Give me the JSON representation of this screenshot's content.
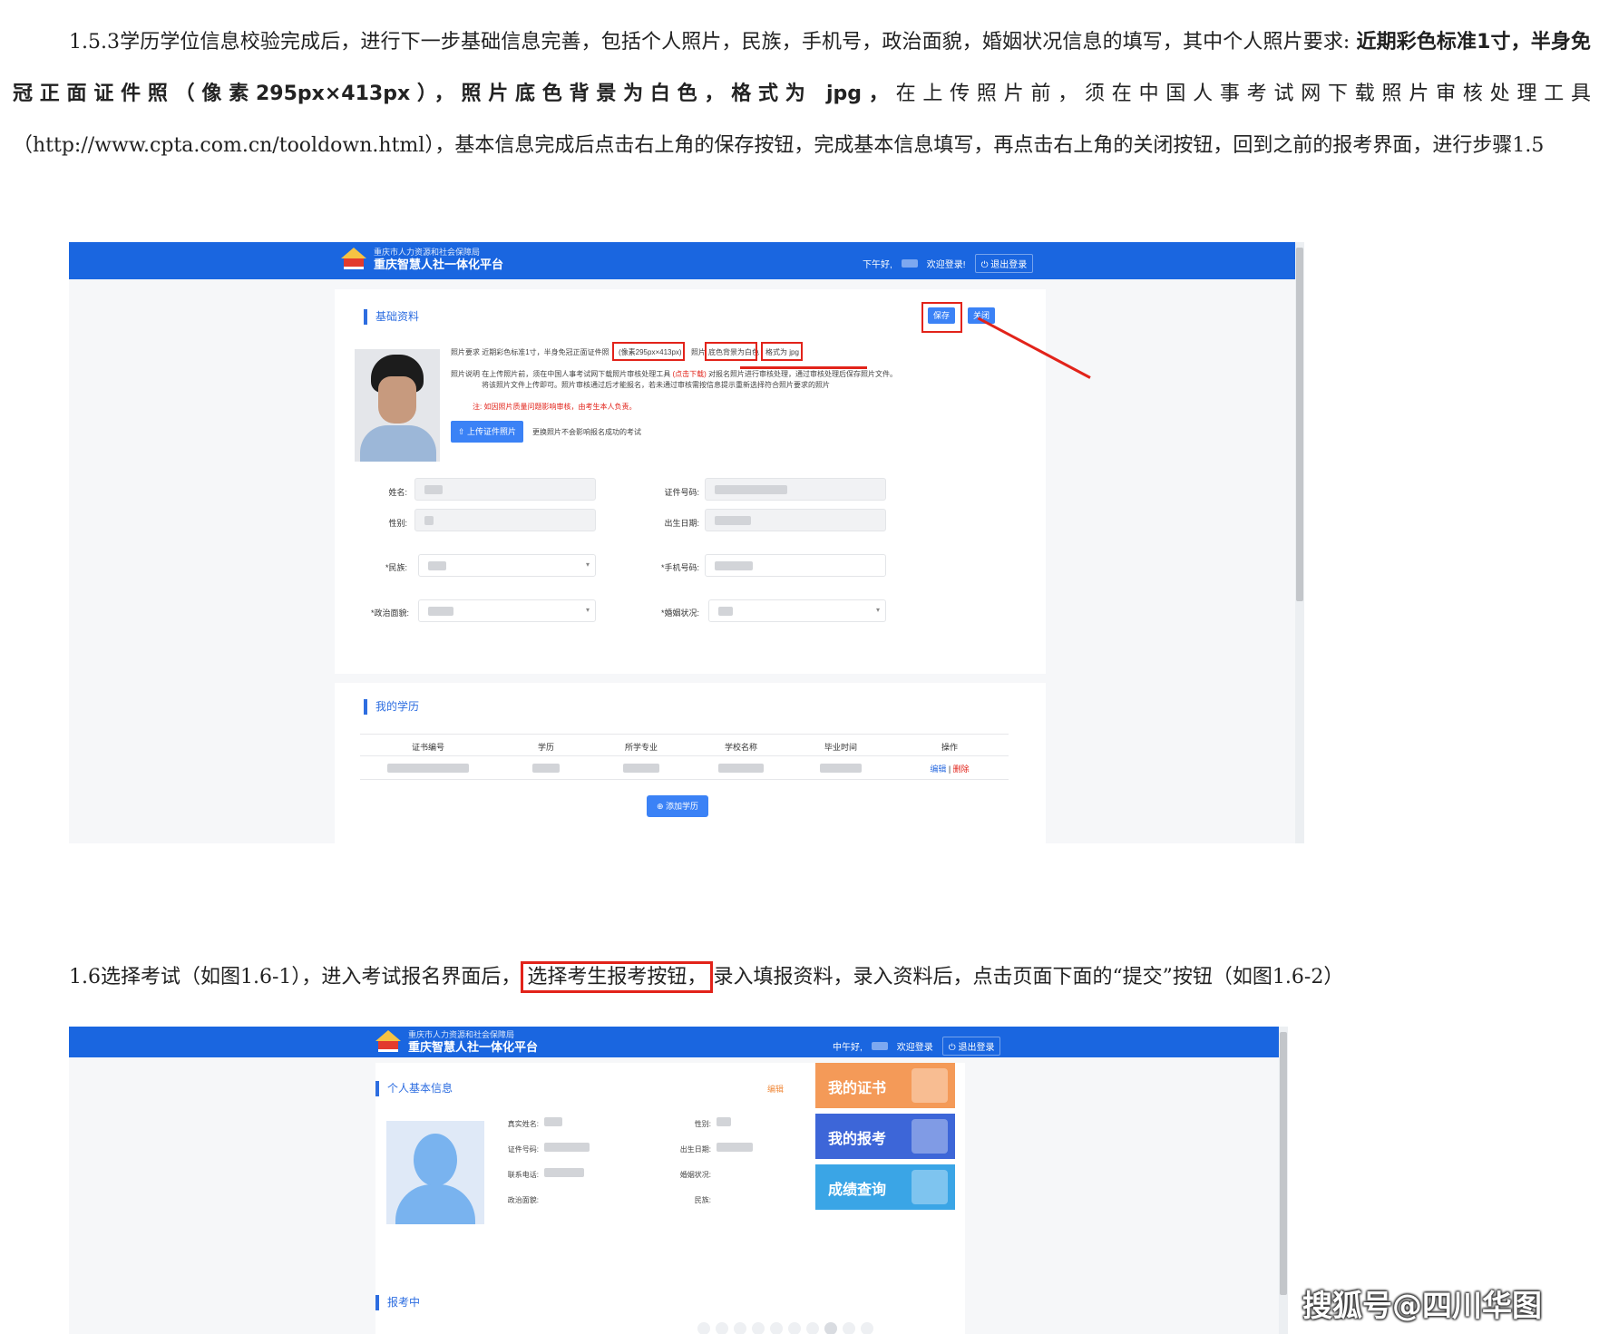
{
  "paragraph1": {
    "segment_a": "1.5.3学历学位信息校验完成后，进行下一步基础信息完善，包括个人照片，民族，手机号，政治面貌，婚姻状况信息的填写，其中个人照片要求: ",
    "segment_bold": "近期彩色标准1寸，半身免冠正面证件照（像素295px×413px），照片底色背景为白色，格式为 jpg，",
    "segment_b": "在上传照片前，须在中国人事考试网下载照片审核处理工具（http://www.cpta.com.cn/tooldown.html），基本信息完成后点击右上角的保存按钮，完成基本信息填写，再点击右上角的关闭按钮，回到之前的报考界面，进行步骤1.5"
  },
  "paragraph2": {
    "before": "1.6选择考试（如图1.6-1），进入考试报名界面后，",
    "highlight": "选择考生报考按钮，",
    "after": "录入填报资料，录入资料后，点击页面下面的“提交”按钮（如图1.6-2）"
  },
  "app": {
    "org_name": "重庆市人力资源和社会保障局",
    "platform_name": "重庆智慧人社一体化平台",
    "logout_label": "退出登录"
  },
  "shot1": {
    "greeting": "下午好,",
    "welcome": "欢迎登录!",
    "section_basic": "基础资料",
    "save_label": "保存",
    "close_label": "关闭",
    "photo_req_label": "照片要求",
    "photo_req_text": "近期彩色标准1寸，半身免冠正面证件照",
    "photo_req_pixels": "(像素295px×413px)",
    "photo_req_bg_prefix": "照片",
    "photo_req_bg": "底色背景为白色",
    "photo_req_format": "格式为 jpg",
    "photo_note_label": "照片说明",
    "photo_note_text_1": "在上传照片前，须在中国人事考试网下载照片审核处理工具",
    "photo_note_link": "(点击下载)",
    "photo_note_text_2": "对报名照片进行审核处理，通过审核处理后保存照片文件。",
    "photo_note_text_3": "将该照片文件上传即可。照片审核通过后才能报名，若未通过审核需按信息提示重新选择符合照片要求的照片",
    "photo_warning": "注: 如因照片质量问题影响审核，由考生本人负责。",
    "upload_label": "上传证件照片",
    "upload_hint": "更换照片不会影响报名成功的考试",
    "fields": {
      "name": "姓名:",
      "id_number": "证件号码:",
      "gender": "性别:",
      "birth_date": "出生日期:",
      "ethnicity": "*民族:",
      "phone": "*手机号码:",
      "political_status": "*政治面貌:",
      "marital_status": "*婚姻状况:"
    },
    "section_education": "我的学历",
    "edu_headers": [
      "证书编号",
      "学历",
      "所学专业",
      "学校名称",
      "毕业时间",
      "操作"
    ],
    "edu_action_edit": "编辑",
    "edu_action_delete": "删除",
    "add_education_label": "添加学历"
  },
  "shot2": {
    "greeting": "中午好,",
    "welcome": "欢迎登录",
    "section_personal": "个人基本信息",
    "edit_label": "编辑",
    "fields_left": [
      "真实姓名:",
      "证件号码:",
      "联系电话:",
      "政治面貌:"
    ],
    "fields_right": [
      "性别:",
      "出生日期:",
      "婚姻状况:",
      "民族:"
    ],
    "tile_cert": "我的证书",
    "tile_apply": "我的报考",
    "tile_score": "成绩查询",
    "section_applying": "报考中"
  },
  "watermark": "搜狐号@四川华图",
  "colors": {
    "brand_blue": "#1a66e0",
    "highlight_red": "#e2231a",
    "button_blue": "#3b82f6"
  }
}
